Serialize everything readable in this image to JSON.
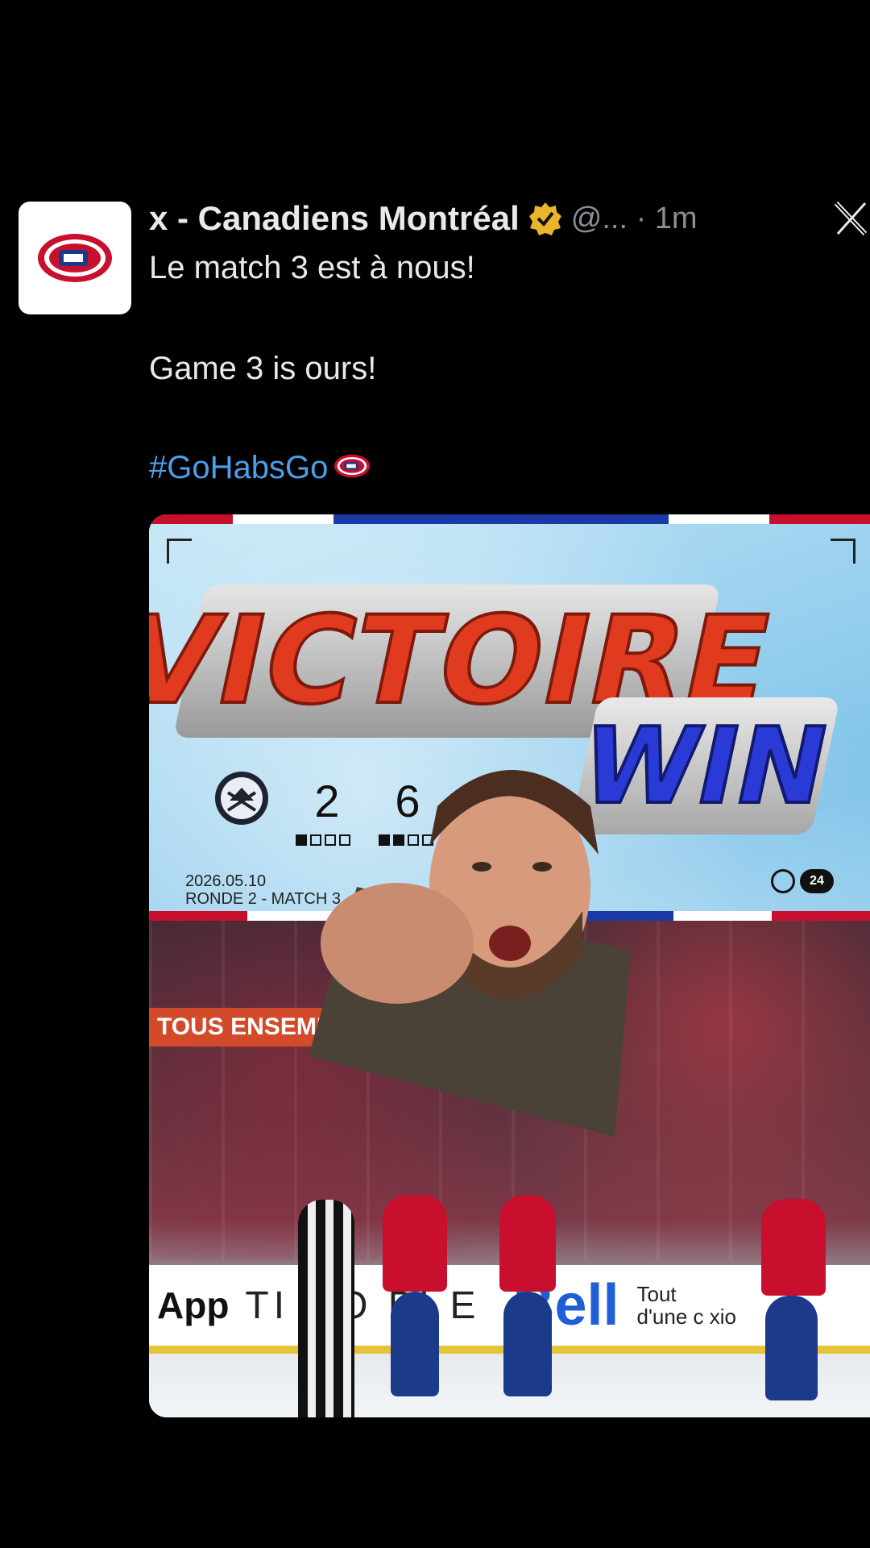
{
  "tweet": {
    "display_name": "x - Canadiens Montréal",
    "handle_time": "@... · 1m",
    "line1": "Le match 3 est à nous!",
    "line2": "Game 3 is ours!",
    "hashtag": "#GoHabsGo"
  },
  "media": {
    "headline": "VICTOIRE",
    "subheadline": "WIN",
    "score_away": "2",
    "score_home": "6",
    "date": "2026.05.10",
    "round": "RONDE 2 - MATCH 3",
    "banner": "TOUS ENSEMBLE",
    "board_app": "App",
    "board_mid": "TI  HO   BI  E",
    "board_brand": "Bell",
    "board_tout_1": "Tout",
    "board_tout_2": "d'une c  xio",
    "network_badge": "24"
  },
  "colors": {
    "background": "#000000",
    "text": "#e7e9ea",
    "hashtag": "#4a9fe8",
    "verified": "#e8b52b",
    "habs_red": "#c8102e",
    "habs_blue": "#1b3a8a"
  },
  "icons": [
    "canadiens-logo-icon",
    "verified-badge-icon",
    "x-logo-icon",
    "sabres-logo-icon"
  ]
}
